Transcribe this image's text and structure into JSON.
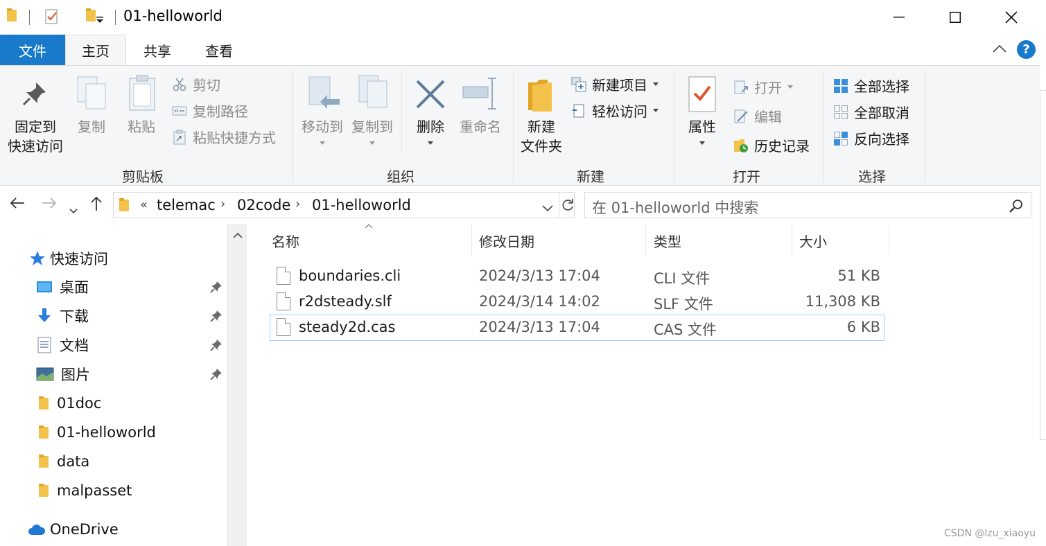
{
  "window": {
    "title": "01-helloworld",
    "minimize": "—",
    "maximize": "☐",
    "close": "✕"
  },
  "tabs": [
    {
      "label": "文件"
    },
    {
      "label": "主页"
    },
    {
      "label": "共享"
    },
    {
      "label": "查看"
    }
  ],
  "ribbon": {
    "clipboard": {
      "group_label": "剪贴板",
      "pin": [
        "固定到",
        "快速访问"
      ],
      "copy": "复制",
      "paste": "粘贴",
      "cut": "剪切",
      "copy_path": "复制路径",
      "paste_shortcut": "粘贴快捷方式"
    },
    "organize": {
      "group_label": "组织",
      "move_to": "移动到",
      "copy_to": "复制到",
      "delete": "删除",
      "rename": "重命名"
    },
    "new": {
      "group_label": "新建",
      "new_folder": [
        "新建",
        "文件夹"
      ],
      "new_item": "新建项目",
      "easy_access": "轻松访问"
    },
    "open": {
      "group_label": "打开",
      "properties": "属性",
      "open": "打开",
      "edit": "编辑",
      "history": "历史记录"
    },
    "select": {
      "group_label": "选择",
      "select_all": "全部选择",
      "select_none": "全部取消",
      "invert": "反向选择"
    }
  },
  "address": {
    "overflow": "«",
    "crumbs": [
      "telemac",
      "02code",
      "01-helloworld"
    ],
    "search_placeholder": "在 01-helloworld 中搜索"
  },
  "nav": {
    "quick_access": "快速访问",
    "items": [
      {
        "label": "桌面",
        "pinned": true,
        "icon": "desktop-icon"
      },
      {
        "label": "下载",
        "pinned": true,
        "icon": "download-icon"
      },
      {
        "label": "文档",
        "pinned": true,
        "icon": "document-icon"
      },
      {
        "label": "图片",
        "pinned": true,
        "icon": "pictures-icon"
      },
      {
        "label": "01doc",
        "pinned": false,
        "icon": "folder-icon"
      },
      {
        "label": "01-helloworld",
        "pinned": false,
        "icon": "folder-icon"
      },
      {
        "label": "data",
        "pinned": false,
        "icon": "folder-icon"
      },
      {
        "label": "malpasset",
        "pinned": false,
        "icon": "folder-icon"
      }
    ],
    "onedrive": "OneDrive"
  },
  "columns": {
    "name": "名称",
    "modified": "修改日期",
    "type": "类型",
    "size": "大小"
  },
  "files": [
    {
      "name": "boundaries.cli",
      "modified": "2024/3/13 17:04",
      "type": "CLI 文件",
      "size": "51 KB",
      "selected": false
    },
    {
      "name": "r2dsteady.slf",
      "modified": "2024/3/14 14:02",
      "type": "SLF 文件",
      "size": "11,308 KB",
      "selected": false
    },
    {
      "name": "steady2d.cas",
      "modified": "2024/3/13 17:04",
      "type": "CAS 文件",
      "size": "6 KB",
      "selected": true
    }
  ],
  "watermark": "CSDN @lzu_xiaoyu",
  "colors": {
    "accent": "#1979ca",
    "folder": "#f3c24a",
    "selection_border": "#99d1ff",
    "help": "#1979ca"
  }
}
